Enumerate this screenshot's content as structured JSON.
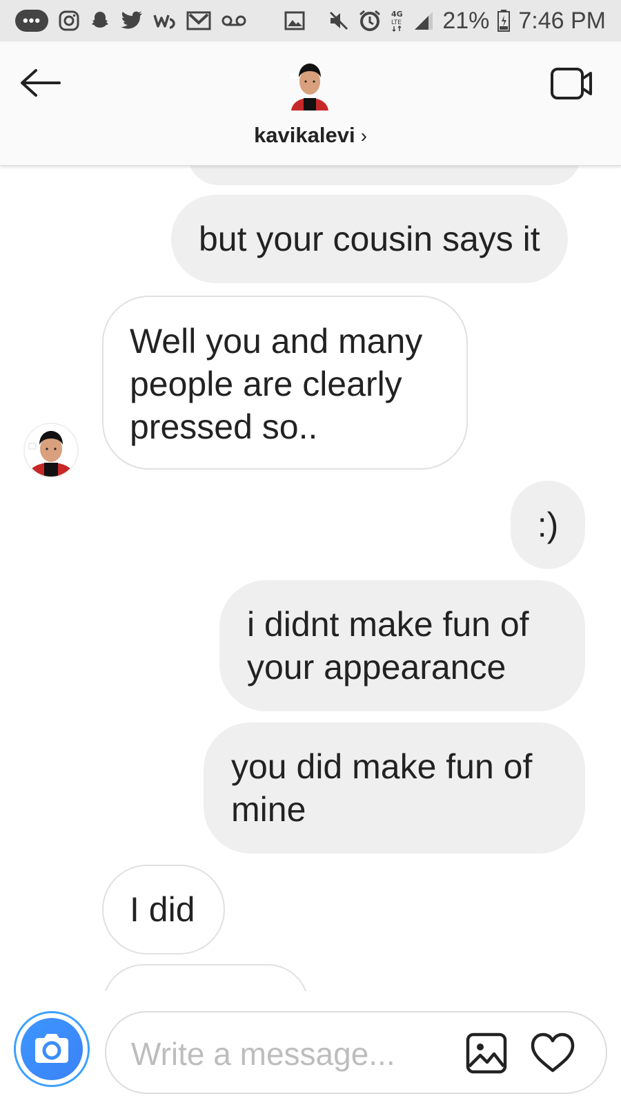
{
  "status_bar": {
    "battery": "21%",
    "time": "7:46 PM",
    "network": "4G LTE",
    "icons": [
      "more-icon",
      "instagram-icon",
      "snapchat-icon",
      "twitter-icon",
      "webtoon-icon",
      "gmail-icon",
      "voicemail-icon",
      "image-icon",
      "mute-icon",
      "alarm-icon",
      "lte-icon",
      "signal-icon",
      "battery-icon"
    ]
  },
  "header": {
    "username": "kavikalevi",
    "chevron": "›",
    "icons": [
      "back-arrow-icon",
      "video-call-icon"
    ]
  },
  "messages": [
    {
      "from": "me",
      "text": "but your cousin says it"
    },
    {
      "from": "them",
      "text": "Well you and many people are clearly pressed so.."
    },
    {
      "from": "me",
      "text": ":)"
    },
    {
      "from": "me",
      "text": "i didnt make fun of your appearance"
    },
    {
      "from": "me",
      "text": "you did make fun of mine"
    },
    {
      "from": "them",
      "text": "I did"
    }
  ],
  "composer": {
    "placeholder": "Write a message...",
    "icons": [
      "camera-icon",
      "gallery-icon",
      "heart-icon"
    ]
  },
  "colors": {
    "outgoing_bubble": "#efefef",
    "camera_blue": "#3b8ef7"
  }
}
